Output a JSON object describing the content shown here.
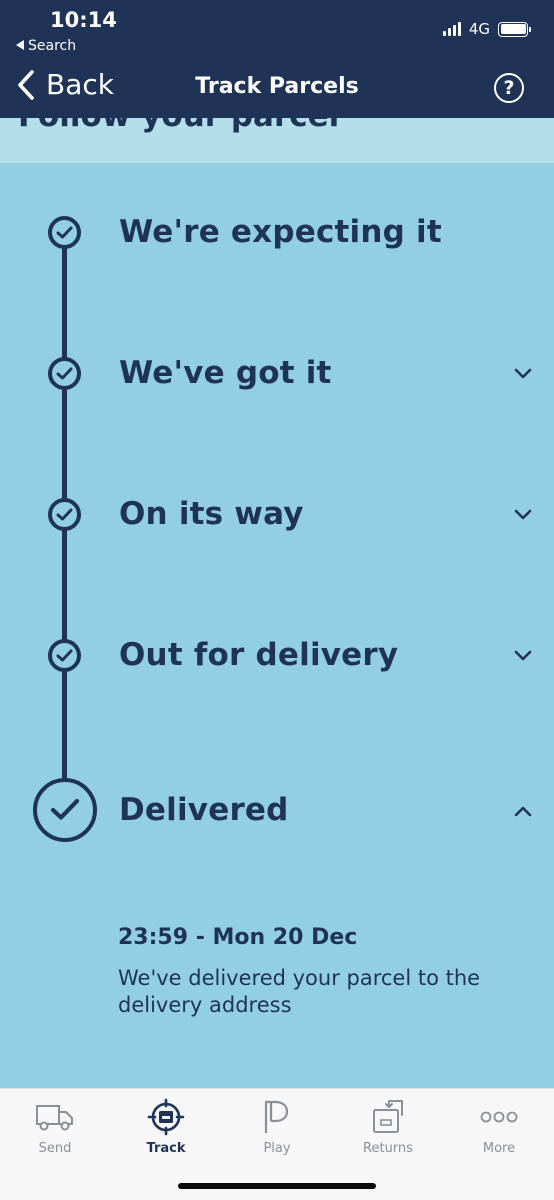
{
  "status_bar": {
    "time": "10:14",
    "back_app": "Search",
    "network": "4G"
  },
  "nav": {
    "back_label": "Back",
    "title": "Track Parcels",
    "help_icon": "?"
  },
  "section": {
    "heading": "Follow your parcel"
  },
  "timeline": {
    "steps": [
      {
        "label": "We're expecting it",
        "state": "complete",
        "expandable": false
      },
      {
        "label": "We've got it",
        "state": "complete",
        "expandable": true,
        "expanded": false
      },
      {
        "label": "On its way",
        "state": "complete",
        "expandable": true,
        "expanded": false
      },
      {
        "label": "Out for delivery",
        "state": "complete",
        "expandable": true,
        "expanded": false
      },
      {
        "label": "Delivered",
        "state": "complete",
        "expandable": true,
        "expanded": true
      }
    ],
    "delivered_detail": {
      "time": "23:59 - Mon 20 Dec",
      "message": "We've delivered your parcel to the delivery address"
    }
  },
  "tabbar": {
    "tabs": [
      {
        "label": "Send",
        "icon": "van-icon"
      },
      {
        "label": "Track",
        "icon": "track-target-icon",
        "active": true
      },
      {
        "label": "Play",
        "icon": "play-p-icon"
      },
      {
        "label": "Returns",
        "icon": "returns-box-icon"
      },
      {
        "label": "More",
        "icon": "more-dots-icon"
      }
    ]
  },
  "colors": {
    "navy": "#1f3356",
    "background": "#92cfe2",
    "section_band": "#b3deea",
    "tabbar": "#f7f7f7",
    "tab_inactive": "#8a8f98"
  }
}
